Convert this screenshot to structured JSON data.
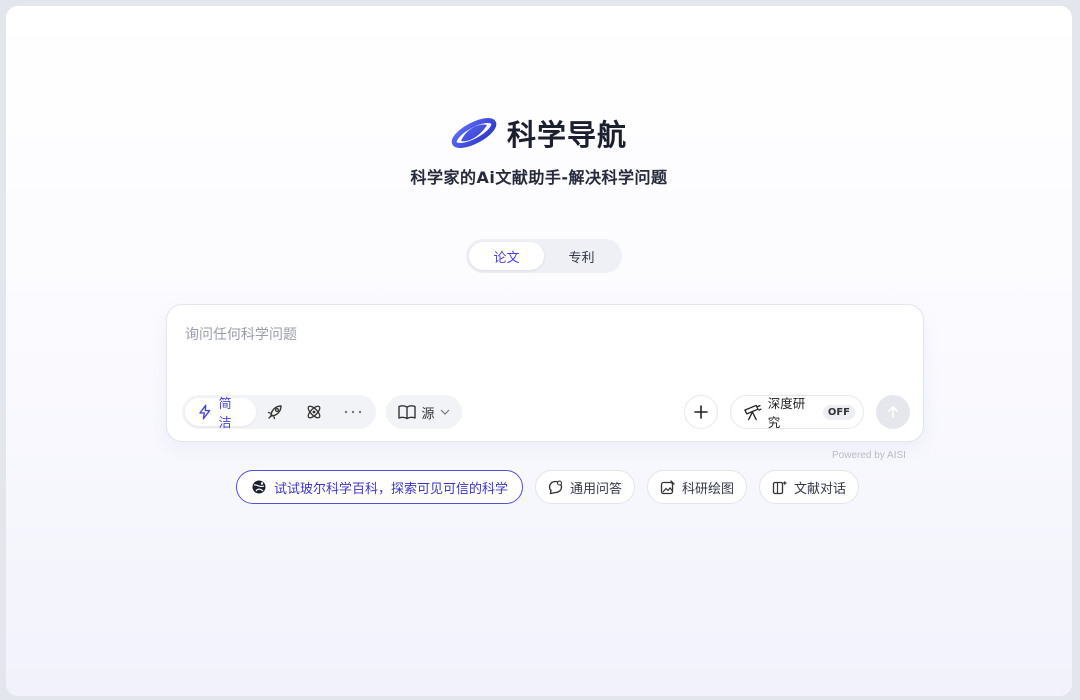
{
  "brand": {
    "name": "科学导航",
    "subtitle": "科学家的Ai文献助手-解决科学问题",
    "accent_color": "#4a45d4"
  },
  "tabs": [
    {
      "label": "论文",
      "active": true
    },
    {
      "label": "专利",
      "active": false
    }
  ],
  "search": {
    "placeholder": "询问任何科学问题",
    "value": ""
  },
  "toolbar": {
    "modes": [
      {
        "label": "简洁",
        "icon": "lightning-icon",
        "active": true
      },
      {
        "label": "",
        "icon": "rocket-icon",
        "active": false
      },
      {
        "label": "",
        "icon": "atom-icon",
        "active": false
      },
      {
        "label": "",
        "icon": "more-dots-icon",
        "active": false
      }
    ],
    "source_label": "源",
    "deep_research_label": "深度研究",
    "deep_research_state": "OFF"
  },
  "powered_by": "Powered by AISI",
  "chips": [
    {
      "label": "试试玻尔科学百科，探索可见可信的科学",
      "icon": "science-globe-icon"
    },
    {
      "label": "通用问答",
      "icon": "chat-icon"
    },
    {
      "label": "科研绘图",
      "icon": "image-edit-icon"
    },
    {
      "label": "文献对话",
      "icon": "document-chat-icon"
    }
  ]
}
